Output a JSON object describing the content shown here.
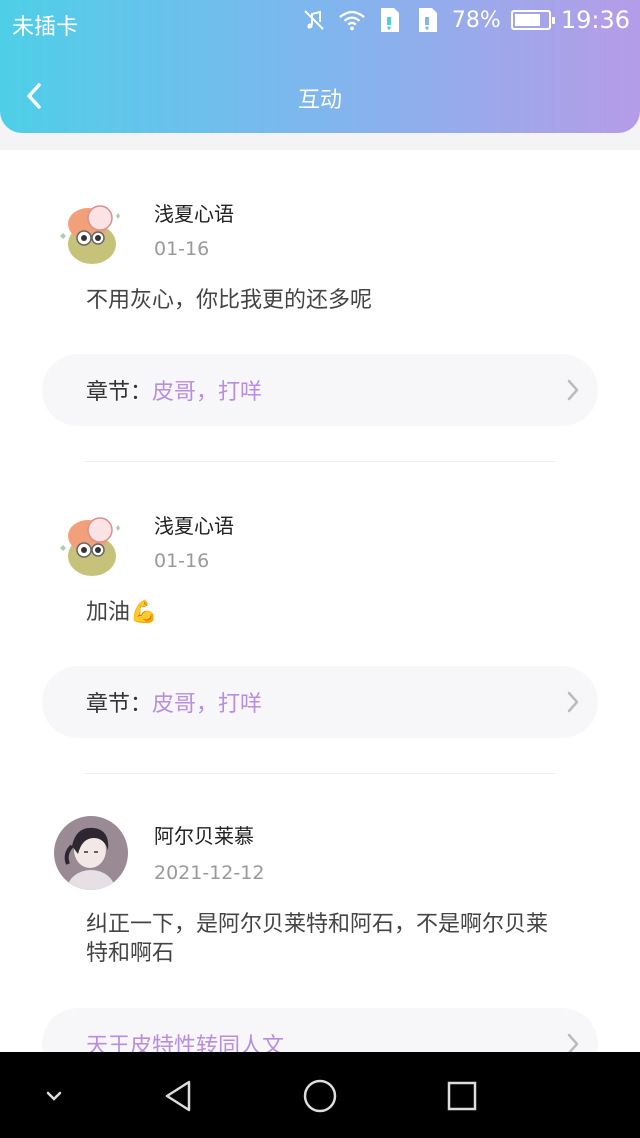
{
  "status_bar": {
    "carrier": "未插卡",
    "battery_percent": "78%",
    "battery_level": 0.78,
    "time": "19:36"
  },
  "header": {
    "title": "互动"
  },
  "chapter_label": "章节：",
  "comments": [
    {
      "username": "浅夏心语",
      "date": "01-16",
      "text": "不用灰心，你比我更的还多呢",
      "chapter": "皮哥，打咩"
    },
    {
      "username": "浅夏心语",
      "date": "01-16",
      "text": "加油",
      "emoji": "💪",
      "chapter": "皮哥，打咩"
    },
    {
      "username": "阿尔贝莱慕",
      "date": "2021-12-12",
      "text": "纠正一下，是阿尔贝莱特和阿石，不是啊尔贝莱特和啊石",
      "chapter": "天王皮特性转同人文"
    }
  ],
  "colors": {
    "header_gradient_start": "#4ecfe8",
    "header_gradient_end": "#b69ce8",
    "chapter_accent": "#b98ee0"
  },
  "icons": {
    "back": "chevron-left-icon",
    "chapter_arrow": "chevron-right-icon",
    "nav_collapse": "chevron-down-icon",
    "nav_back": "triangle-back-icon",
    "nav_home": "circle-home-icon",
    "nav_recents": "square-recents-icon"
  }
}
